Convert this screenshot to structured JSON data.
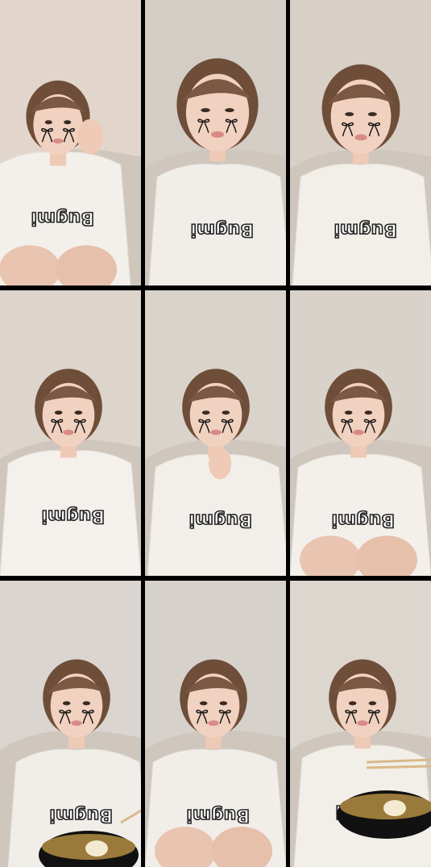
{
  "layout": "3x3 collage of livestream frames",
  "frames": [
    {
      "id": 1,
      "scene": "hands-near-ear",
      "wall": "#e2d6cc",
      "shirt": "#f3efea",
      "food": false
    },
    {
      "id": 2,
      "scene": "close-up-talking",
      "wall": "#d4cdc6",
      "shirt": "#f1eeea",
      "food": false
    },
    {
      "id": 3,
      "scene": "close-up-talking",
      "wall": "#d8cfc6",
      "shirt": "#f2eee8",
      "food": false
    },
    {
      "id": 4,
      "scene": "seated",
      "wall": "#ddd4cc",
      "shirt": "#f4f1ec",
      "food": false
    },
    {
      "id": 5,
      "scene": "hand-at-chin",
      "wall": "#d9d3cc",
      "shirt": "#f2efea",
      "food": false
    },
    {
      "id": 6,
      "scene": "seated-knees-up",
      "wall": "#d9d2cb",
      "shirt": "#f3f0ec",
      "food": false
    },
    {
      "id": 7,
      "scene": "eating-ramen",
      "wall": "#dad5d0",
      "shirt": "#f1eeea",
      "food": true
    },
    {
      "id": 8,
      "scene": "seated-knees-up",
      "wall": "#d6d1cb",
      "shirt": "#f1eeea",
      "food": false
    },
    {
      "id": 9,
      "scene": "holding-bowl-chopsticks",
      "wall": "#ddd6ce",
      "shirt": "#f2efe9",
      "food": true
    }
  ],
  "overlay_icons": [
    "bow-tear-icon-left",
    "bow-tear-icon-right"
  ]
}
